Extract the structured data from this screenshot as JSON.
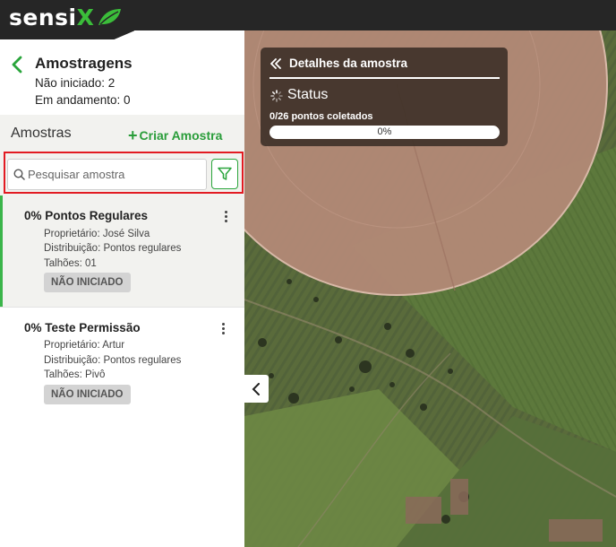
{
  "brand": {
    "logo_text": "sensi",
    "logo_x": "X",
    "accent": "#3bbd3a"
  },
  "sidebar": {
    "title": "Amostragens",
    "status_not_started": "Não iniciado: 2",
    "status_in_progress": "Em andamento: 0",
    "samples_label": "Amostras",
    "create_label": "Criar Amostra",
    "search": {
      "placeholder": "Pesquisar amostra",
      "value": ""
    },
    "cards": [
      {
        "title": "0% Pontos Regulares",
        "owner": "Proprietário: José Silva",
        "distribution": "Distribuição: Pontos regulares",
        "plots": "Talhões: 01",
        "status": "NÃO INICIADO",
        "selected": true
      },
      {
        "title": "0% Teste Permissão",
        "owner": "Proprietário: Artur",
        "distribution": "Distribuição: Pontos regulares",
        "plots": "Talhões: Pivô",
        "status": "NÃO INICIADO",
        "selected": false
      }
    ]
  },
  "details": {
    "title": "Detalhes da amostra",
    "status_label": "Status",
    "points_label": "0/26 pontos coletados",
    "progress": 0,
    "progress_text": "0%"
  },
  "colors": {
    "green": "#3bb54a",
    "highlight": "#e21b22",
    "topbar": "#262626"
  }
}
